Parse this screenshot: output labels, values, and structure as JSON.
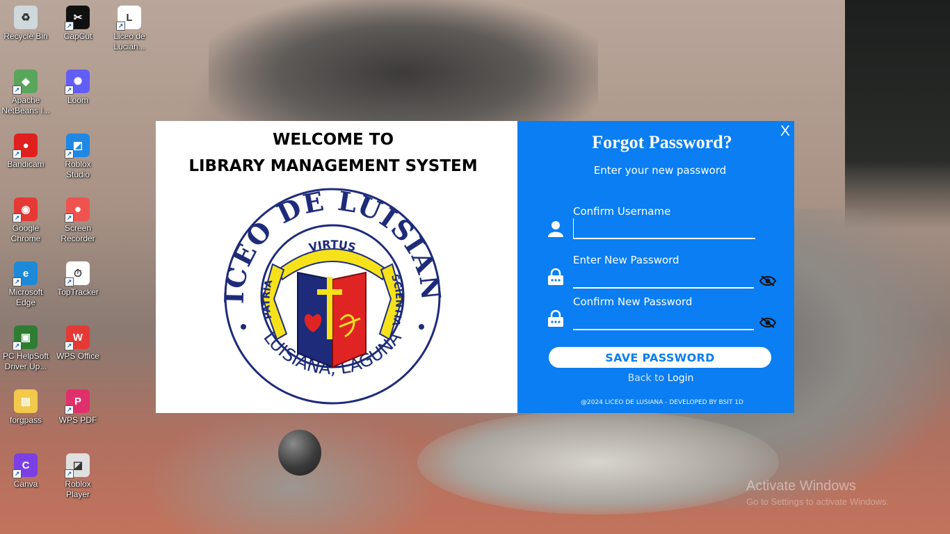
{
  "desktop": {
    "icons": [
      {
        "label": "Recycle Bin",
        "icon": "recycle-bin-icon",
        "color": "#cfd8dc",
        "glyph": "♻"
      },
      {
        "label": "CapCut",
        "icon": "capcut-icon",
        "color": "#111111",
        "glyph": "✂"
      },
      {
        "label": "Liceo de Lucian...",
        "icon": "liceo-icon",
        "color": "#ffffff",
        "glyph": "L"
      },
      {
        "label": "Apache NetBeans I...",
        "icon": "netbeans-icon",
        "color": "#5aa55c",
        "glyph": "◆"
      },
      {
        "label": "Loom",
        "icon": "loom-icon",
        "color": "#625df5",
        "glyph": "✺"
      },
      {
        "label": "Bandicam",
        "icon": "bandicam-icon",
        "color": "#e01f1f",
        "glyph": "●"
      },
      {
        "label": "Roblox Studio",
        "icon": "roblox-studio-icon",
        "color": "#1e88e5",
        "glyph": "◩"
      },
      {
        "label": "Google Chrome",
        "icon": "chrome-icon",
        "color": "#e53935",
        "glyph": "◉"
      },
      {
        "label": "Screen Recorder",
        "icon": "screen-recorder-icon",
        "color": "#ef5350",
        "glyph": "⏺"
      },
      {
        "label": "Microsoft Edge",
        "icon": "edge-icon",
        "color": "#1c8ad8",
        "glyph": "e"
      },
      {
        "label": "TopTracker",
        "icon": "toptracker-icon",
        "color": "#ffffff",
        "glyph": "⏱"
      },
      {
        "label": "PC HelpSoft Driver Up...",
        "icon": "pc-helpsoft-icon",
        "color": "#2e7d32",
        "glyph": "▣"
      },
      {
        "label": "WPS Office",
        "icon": "wps-office-icon",
        "color": "#e53935",
        "glyph": "W"
      },
      {
        "label": "forgpass",
        "icon": "folder-icon",
        "color": "#f2c94c",
        "glyph": "▤"
      },
      {
        "label": "WPS PDF",
        "icon": "wps-pdf-icon",
        "color": "#e0306b",
        "glyph": "P"
      },
      {
        "label": "Canva",
        "icon": "canva-icon",
        "color": "#7b3fe4",
        "glyph": "C"
      },
      {
        "label": "Roblox Player",
        "icon": "roblox-player-icon",
        "color": "#e0e0e0",
        "glyph": "◪"
      }
    ]
  },
  "left_panel": {
    "welcome_line1": "WELCOME TO",
    "welcome_line2": "LIBRARY MANAGEMENT SYSTEM",
    "logo": {
      "ring_top_text": "LICEO DE LUISIANA",
      "ring_bottom_text": "LUISIANA, LAGUNA",
      "banner_top": "VIRTUS",
      "banner_left": "PATRIA",
      "banner_right": "SCIENTIA"
    }
  },
  "right_panel": {
    "title": "Forgot Password?",
    "subtitle": "Enter your new password",
    "close_label": "X",
    "fields": {
      "username_label": "Confirm Username",
      "username_value": "",
      "new_password_label": "Enter New Password",
      "new_password_value": "",
      "confirm_password_label": "Confirm New Password",
      "confirm_password_value": ""
    },
    "save_button": "SAVE PASSWORD",
    "back_text": "Back to",
    "login_link": "Login",
    "footer": "@2024 LICEO DE LUSIANA - DEVELOPED BY BSIT  1D",
    "accent_color": "#0a7ef2"
  },
  "watermark": {
    "line1": "Activate Windows",
    "line2": "Go to Settings to activate Windows."
  }
}
